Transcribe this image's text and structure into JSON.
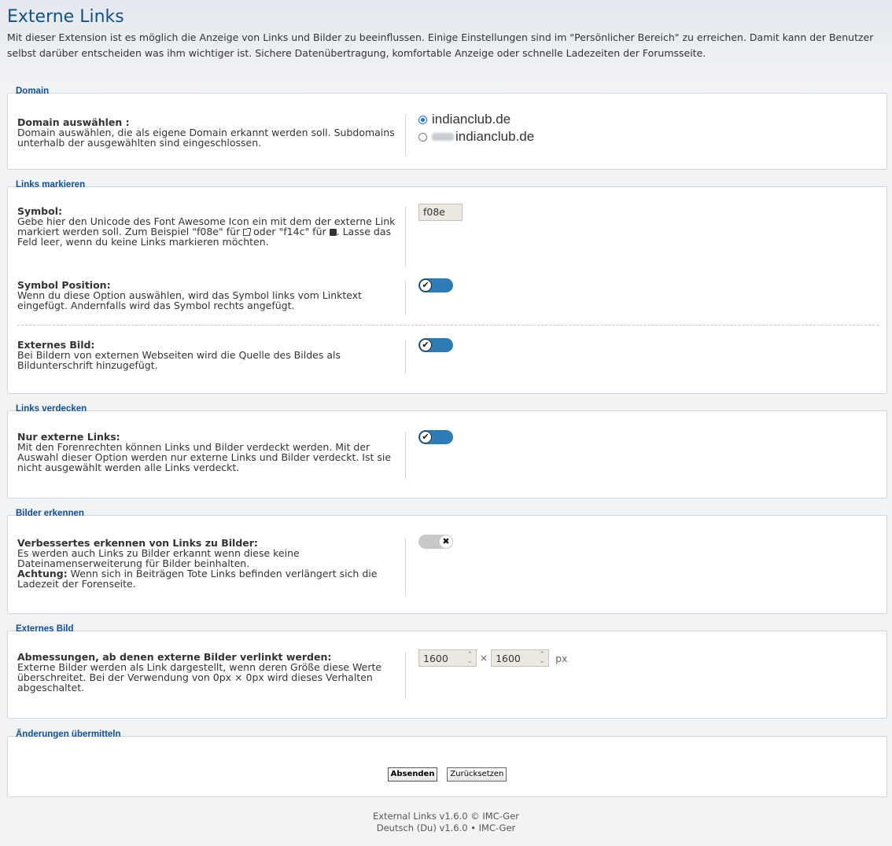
{
  "page": {
    "title": "Externe Links",
    "intro": "Mit dieser Extension ist es möglich die Anzeige von Links und Bilder zu beeinflussen. Einige Einstellungen sind im \"Persönlicher Bereich\" zu erreichen. Damit kann der Benutzer selbst darüber entscheiden was ihm wichtiger ist. Sichere Datenübertragung, komfortable Anzeige oder schnelle Ladezeiten der Forumsseite."
  },
  "domain": {
    "legend": "Domain",
    "label": "Domain auswählen :",
    "explain": "Domain auswählen, die als eigene Domain erkannt werden soll. Subdomains unterhalb der ausgewählten sind eingeschlossen.",
    "options": [
      "indianclub.de",
      "indianclub.de"
    ],
    "selected_index": 0
  },
  "links_markieren": {
    "legend": "Links markieren",
    "symbol_label": "Symbol:",
    "symbol_explain_1": "Gebe hier den Unicode des Font Awesome Icon ein mit dem der externe Link markiert werden soll. Zum Beispiel \"f08e\" für",
    "symbol_explain_2": "oder \"f14c\" für",
    "symbol_explain_3": ". Lasse das Feld leer, wenn du keine Links markieren möchten.",
    "symbol_value": "f08e",
    "position_label": "Symbol Position:",
    "position_explain": "Wenn du diese Option auswählen, wird das Symbol links vom Linktext eingefügt. Andernfalls wird das Symbol rechts angefügt.",
    "position_on": true,
    "ext_image_label": "Externes Bild:",
    "ext_image_explain": "Bei Bildern von externen Webseiten wird die Quelle des Bildes als Bildunterschrift hinzugefügt.",
    "ext_image_on": true
  },
  "links_verdecken": {
    "legend": "Links verdecken",
    "label": "Nur externe Links:",
    "explain": "Mit den Forenrechten können Links und Bilder verdeckt werden. Mit der Auswahl dieser Option werden nur externe Links und Bilder verdeckt. Ist sie nicht ausgewählt werden alle Links verdeckt.",
    "on": true
  },
  "bilder_erkennen": {
    "legend": "Bilder erkennen",
    "label": "Verbessertes erkennen von Links zu Bilder:",
    "explain": "Es werden auch Links zu Bilder erkannt wenn diese keine Dateinamenserweiterung für Bilder beinhalten.",
    "warn_label": "Achtung:",
    "warn_text": " Wenn sich in Beiträgen Tote Links befinden verlängert sich die Ladezeit der Forenseite.",
    "on": false
  },
  "externes_bild": {
    "legend": "Externes Bild",
    "label": "Abmessungen, ab denen externe Bilder verlinkt werden:",
    "explain": "Externe Bilder werden als Link dargestellt, wenn deren Größe diese Werte überschreitet. Bei der Verwendung von 0px × 0px wird dieses Verhalten abgeschaltet.",
    "width": "1600",
    "height": "1600",
    "times": "×",
    "unit": "px"
  },
  "submit": {
    "legend": "Änderungen übermitteln",
    "submit_label": "Absenden",
    "reset_label": "Zurücksetzen"
  },
  "footer": {
    "line1": "External Links v1.6.0 © IMC-Ger",
    "line2": "Deutsch (Du) v1.6.0 • IMC-Ger"
  },
  "icons": {
    "toggle_on": "check-icon",
    "toggle_off": "x-icon"
  },
  "colors": {
    "accent": "#105289",
    "toggle_on": "#2f7bb5",
    "toggle_off": "#c9c9c9"
  }
}
